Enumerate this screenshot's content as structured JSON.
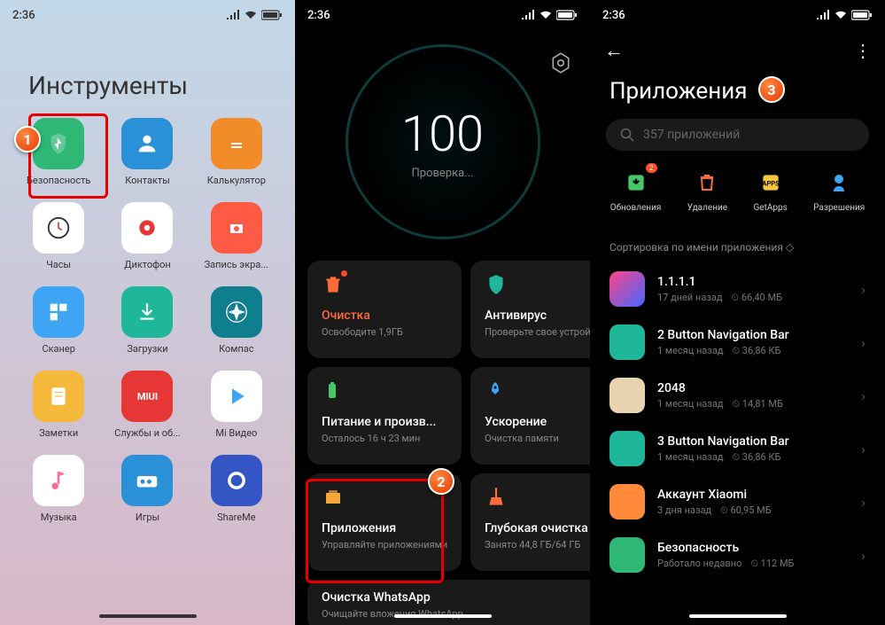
{
  "status": {
    "time": "2:36"
  },
  "screen1": {
    "title": "Инструменты",
    "apps": [
      {
        "label": "Безопасность",
        "color": "#2fb776"
      },
      {
        "label": "Контакты",
        "color": "#2a90d8"
      },
      {
        "label": "Калькулятор",
        "color": "#f28c28"
      },
      {
        "label": "Часы",
        "color": "#ffffff"
      },
      {
        "label": "Диктофон",
        "color": "#ffffff"
      },
      {
        "label": "Запись экра...",
        "color": "#ff5a44"
      },
      {
        "label": "Сканер",
        "color": "#3da5f4"
      },
      {
        "label": "Загрузки",
        "color": "#1fb79a"
      },
      {
        "label": "Компас",
        "color": "#0f7f8f"
      },
      {
        "label": "Заметки",
        "color": "#f4b93a"
      },
      {
        "label": "Службы и об...",
        "color": "#e63636"
      },
      {
        "label": "Mi Видео",
        "color": "#ffffff"
      },
      {
        "label": "Музыка",
        "color": "#ffffff"
      },
      {
        "label": "Игры",
        "color": "#2a90d8"
      },
      {
        "label": "ShareMe",
        "color": "#3356c4"
      }
    ]
  },
  "screen2": {
    "score": "100",
    "scoreSub": "Проверка...",
    "tiles": [
      {
        "title": "Очистка",
        "titleColor": "#ff6a3a",
        "sub": "Освободите 1,9ГБ",
        "icon": "trash",
        "iconColor": "#ff6a3a",
        "dot": true
      },
      {
        "title": "Антивирус",
        "sub": "Проверьте свое устройство",
        "icon": "shield",
        "iconColor": "#1fb79a"
      },
      {
        "title": "Питание и произв...",
        "sub": "Осталось 16 ч 23 мин",
        "icon": "battery",
        "iconColor": "#44c768"
      },
      {
        "title": "Ускорение",
        "sub": "Очистка памяти",
        "icon": "rocket",
        "iconColor": "#3da5f4"
      },
      {
        "title": "Приложения",
        "sub": "Управляйте приложениями",
        "icon": "apps",
        "iconColor": "#f4a83a"
      },
      {
        "title": "Глубокая очистка",
        "sub": "Занято 44,8 ГБ/64 ГБ",
        "icon": "broom",
        "iconColor": "#ff6a3a"
      }
    ],
    "wide": {
      "title": "Очистка WhatsApp",
      "sub": "Очищайте вложения WhatsApp"
    }
  },
  "screen3": {
    "title": "Приложения",
    "searchPlaceholder": "357 приложений",
    "actions": [
      {
        "label": "Обновления",
        "icon": "update",
        "color": "#44c768",
        "badge": "2"
      },
      {
        "label": "Удаление",
        "icon": "trash",
        "color": "#ff6a3a"
      },
      {
        "label": "GetApps",
        "icon": "getapps",
        "color": "#f4c63a"
      },
      {
        "label": "Разрешения",
        "icon": "perm",
        "color": "#3da5f4"
      }
    ],
    "sortLabel": "Сортировка по имени приложения",
    "apps": [
      {
        "name": "1.1.1.1",
        "age": "17 дней назад",
        "size": "66,40 МБ",
        "bg": "linear-gradient(135deg,#ff4488,#4466ff)"
      },
      {
        "name": "2 Button Navigation Bar",
        "age": "1 месяц назад",
        "size": "36,86 КБ",
        "bg": "#1fb79a"
      },
      {
        "name": "2048",
        "age": "1 месяц назад",
        "size": "14,81 МБ",
        "bg": "#e8d4b0"
      },
      {
        "name": "3 Button Navigation Bar",
        "age": "1 месяц назад",
        "size": "36,86 КБ",
        "bg": "#1fb79a"
      },
      {
        "name": "Аккаунт Xiaomi",
        "age": "3 дня назад",
        "size": "60,95 МБ",
        "bg": "#ff8a3a"
      },
      {
        "name": "Безопасность",
        "age": "Работало недавно",
        "size": "112 МБ",
        "bg": "#2fb776"
      }
    ]
  }
}
